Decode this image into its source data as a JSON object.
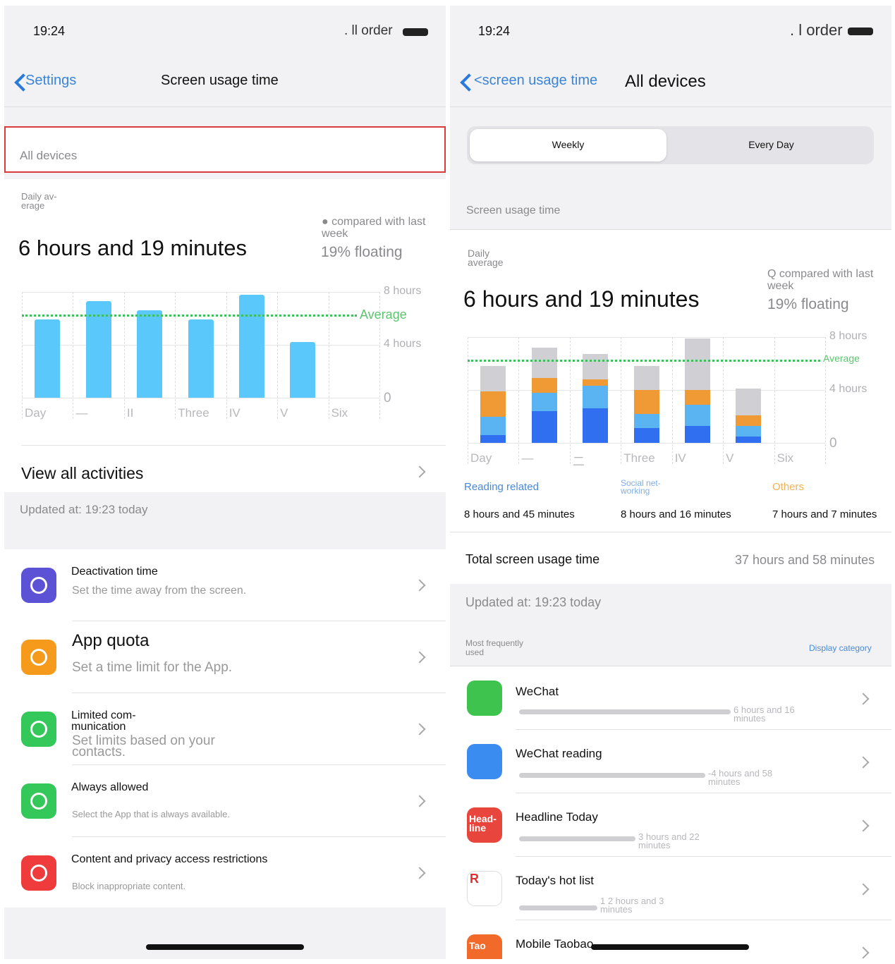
{
  "left": {
    "status": {
      "time": "19:24",
      "carrier": ". ll order"
    },
    "nav": {
      "back": "Settings",
      "title": "Screen usage time"
    },
    "all_devices": "All devices",
    "daily_avg_label": "Daily av-\nerage",
    "daily_avg_value": "6 hours and 19 minutes",
    "compared": "● compared with last week",
    "floating": "19% floating",
    "chart_data": {
      "type": "bar",
      "categories": [
        "Day",
        "—",
        "II",
        "Three",
        "IV",
        "V",
        "Six"
      ],
      "values": [
        5.9,
        7.3,
        6.6,
        5.9,
        7.8,
        4.2,
        0
      ],
      "average": 6.3,
      "average_label": "Average",
      "ylim": [
        0,
        8
      ],
      "y_ticks": [
        "8 hours",
        "4 hours",
        "0"
      ],
      "color": "#5ac8fa"
    },
    "view_all": "View all activities",
    "updated": "Updated at: 19:23 today",
    "settings": [
      {
        "title": "Deactivation time",
        "subtitle": "Set the time away from the screen.",
        "icon": "moon-clock-icon",
        "color": "#5b52d6"
      },
      {
        "title": "App quota",
        "subtitle": "Set a time limit for the App.",
        "icon": "hourglass-icon",
        "color": "#f59a1b"
      },
      {
        "title": "Limited com-\nmunication",
        "subtitle": "Set limits based on your contacts.",
        "icon": "person-circle-icon",
        "color": "#34c759"
      },
      {
        "title": "Always allowed",
        "subtitle": "Select the App that is always available.",
        "icon": "checkmark-seal-icon",
        "color": "#34c759"
      },
      {
        "title": "Content and privacy access restrictions",
        "subtitle": "Block inappropriate content.",
        "icon": "no-entry-icon",
        "color": "#ef3b3b"
      }
    ]
  },
  "right": {
    "status": {
      "time": "19:24",
      "carrier": ". l order"
    },
    "nav": {
      "back": "<screen usage time",
      "title": "All devices"
    },
    "segments": {
      "weekly": "Weekly",
      "daily": "Every Day",
      "selected": "weekly"
    },
    "section_label": "Screen usage time",
    "daily_avg_label": "Daily\naverage",
    "daily_avg_value": "6 hours and 19 minutes",
    "compared": "Q compared with last week",
    "floating": "19% floating",
    "chart_data": {
      "type": "bar",
      "stacked": true,
      "categories": [
        "Day",
        "—",
        "二",
        "Three",
        "IV",
        "V",
        "Six"
      ],
      "series": [
        {
          "values": [
            0.6,
            2.4,
            2.6,
            1.1,
            1.3,
            0.5,
            0
          ],
          "color": "#2f6ff0"
        },
        {
          "values": [
            1.4,
            1.4,
            1.7,
            1.1,
            1.6,
            0.8,
            0
          ],
          "color": "#5ab4f2"
        },
        {
          "values": [
            1.9,
            1.1,
            0.5,
            1.8,
            1.1,
            0.8,
            0
          ],
          "color": "#ef9a35"
        },
        {
          "values": [
            1.9,
            2.3,
            1.9,
            1.8,
            3.9,
            2.0,
            0
          ],
          "color": "#d0d0d4"
        }
      ],
      "average": 6.3,
      "average_label": "Average",
      "ylim": [
        0,
        8
      ],
      "y_ticks": [
        "8 hours",
        "4 hours",
        "0"
      ]
    },
    "categories": [
      {
        "name": "Reading related",
        "time": "8 hours and 45 minutes",
        "color": "#4a8ad4"
      },
      {
        "name": "Social net-\nworking",
        "time": "8 hours and 16 minutes",
        "color": "#7eaee6"
      },
      {
        "name": "Others",
        "time": "7 hours and 7 minutes",
        "color": "#f0b35c"
      }
    ],
    "total_label": "Total screen usage time",
    "total_value": "37 hours and 58 minutes",
    "updated": "Updated at: 19:23 today",
    "most_used": "Most frequently\nused",
    "display_category": "Display category",
    "apps": [
      {
        "name": "WeChat",
        "time": "6 hours and 16 minutes",
        "fraction": 1.0,
        "icon": "wechat-icon",
        "color": "#3fc34f"
      },
      {
        "name": "WeChat reading",
        "time": "-4 hours and 58 minutes",
        "fraction": 0.88,
        "icon": "wechat-reading-icon",
        "color": "#3b8cf0"
      },
      {
        "name": "Headline Today",
        "time": "3 hours and 22 minutes",
        "fraction": 0.55,
        "icon": "headline-icon",
        "color": "#e8453c",
        "icon_text": "Head-\nline"
      },
      {
        "name": "Today's hot list",
        "time": "1 2 hours and 3 minutes",
        "fraction": 0.37,
        "icon": "hot-list-icon",
        "color": "#ffffff",
        "icon_text": "R"
      },
      {
        "name": "Mobile Taobao",
        "time": "",
        "fraction": 0.2,
        "icon": "taobao-icon",
        "color": "#f26a2a",
        "icon_text": "Tao"
      }
    ]
  }
}
